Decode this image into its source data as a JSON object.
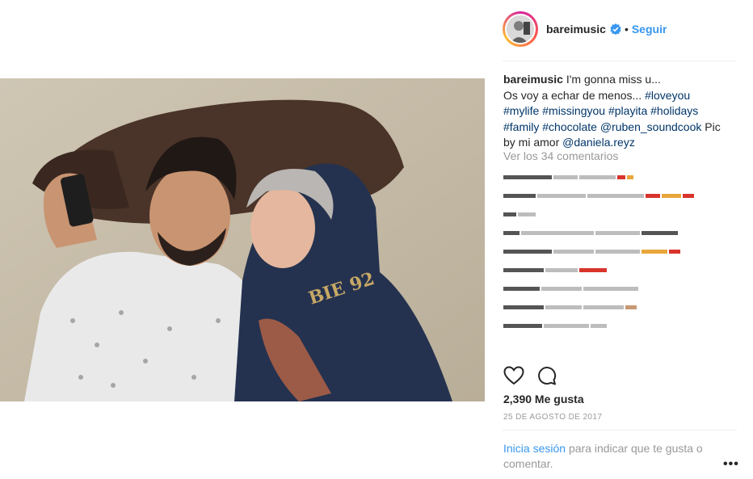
{
  "post": {
    "username": "bareimusic",
    "follow_label": "Seguir",
    "dot": "•",
    "caption_user": "bareimusic",
    "caption_line1": "I'm gonna miss u...",
    "caption_line2": "Os voy a echar de menos...",
    "caption_tags1": [
      "#loveyou"
    ],
    "caption_tags2": [
      "#mylife",
      "#missingyou",
      "#playita",
      "#holidays"
    ],
    "caption_tags3": [
      "#family",
      "#chocolate",
      "@ruben_soundcook"
    ],
    "caption_pic": "Pic",
    "caption_by": "by mi amor",
    "caption_mention": "@daniela.reyz",
    "view_comments": "Ver los 34 comentarios",
    "likes": "2,390 Me gusta",
    "date": "25 DE AGOSTO DE 2017",
    "login_link": "Inicia sesión",
    "login_text": "para indicar que te gusta o comentar.",
    "more_label": "•••"
  },
  "icons": {
    "verified": "verified-badge-icon",
    "like": "heart-icon",
    "comment": "comment-bubble-icon",
    "more": "more-options-icon"
  },
  "colors": {
    "link_blue": "#3897f0",
    "hashtag": "#003569",
    "muted": "#999999",
    "text": "#262626"
  }
}
